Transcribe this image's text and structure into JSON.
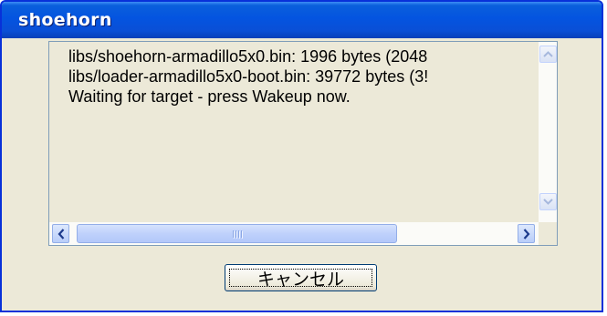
{
  "window": {
    "title": "shoehorn"
  },
  "log": {
    "lines": [
      "libs/shoehorn-armadillo5x0.bin: 1996 bytes (2048",
      "libs/loader-armadillo5x0-boot.bin: 39772 bytes (3!",
      "Waiting for target - press Wakeup now."
    ]
  },
  "scrollbar": {
    "horizontal_thumb_position": 0.0,
    "vertical_thumb_position": 0.0
  },
  "buttons": {
    "cancel_label": "キャンセル"
  },
  "icons": {
    "up": "chevron-up-icon",
    "down": "chevron-down-icon",
    "left": "chevron-left-icon",
    "right": "chevron-right-icon",
    "grip": "scroll-grip-icon"
  },
  "colors": {
    "titlebar": "#0454e0",
    "window_bg": "#ece9d8",
    "border": "#0831d9"
  }
}
